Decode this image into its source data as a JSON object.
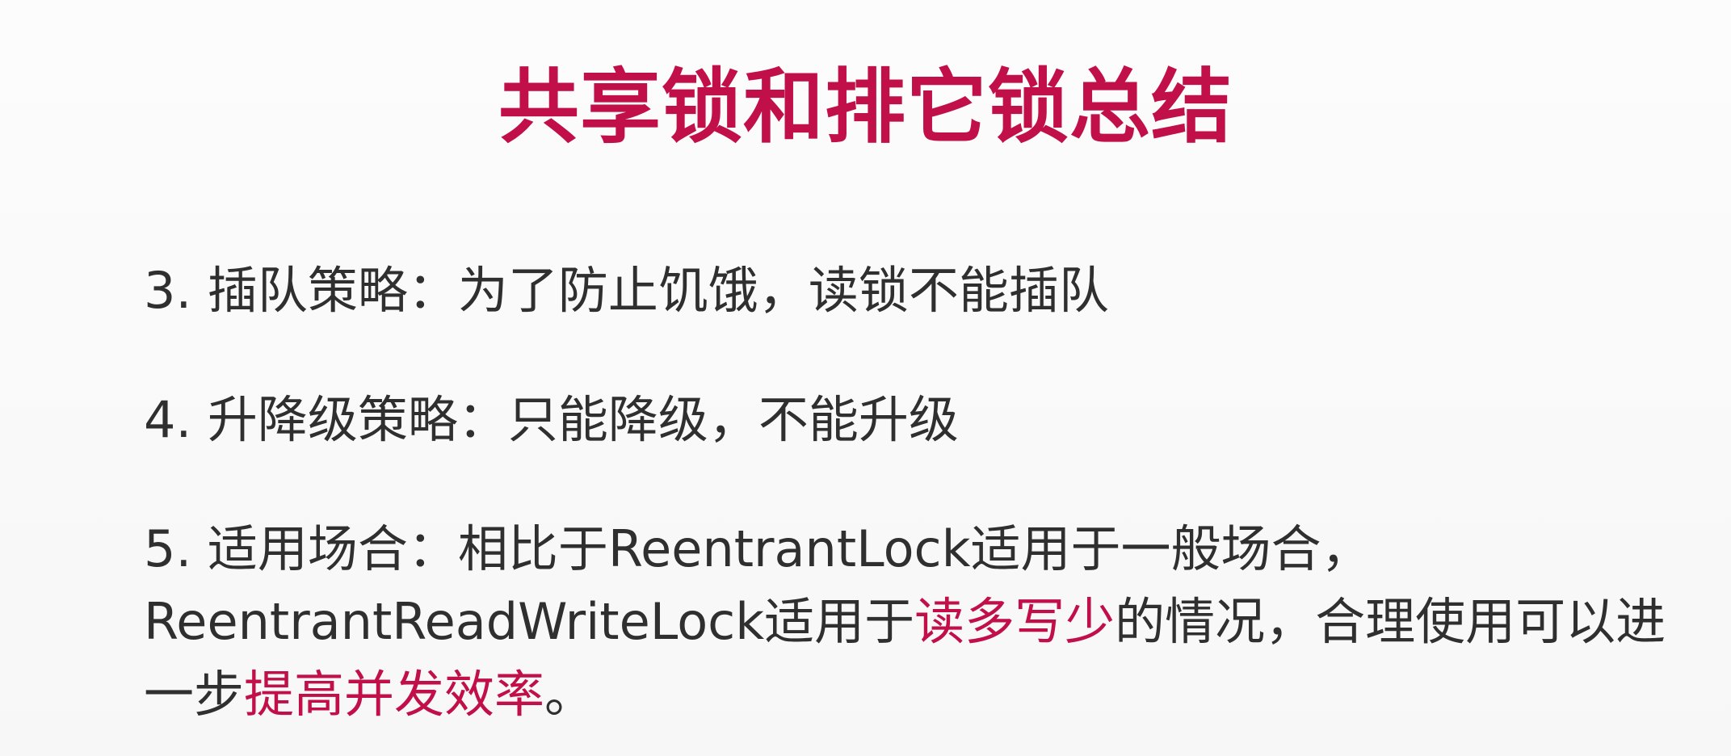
{
  "slide": {
    "title": "共享锁和排它锁总结",
    "points": [
      {
        "text": "3. 插队策略：为了防止饥饿，读锁不能插队"
      },
      {
        "text": "4. 升降级策略：只能降级，不能升级"
      },
      {
        "line1": "5. 适用场合：相比于ReentrantLock适用于一般场合，",
        "line2_pre": "ReentrantReadWriteLock适用于",
        "line2_highlight": "读多写少",
        "line2_post": "的情况，合理使用可以进",
        "line3_pre": "一步",
        "line3_highlight": "提高并发效率",
        "line3_post": "。"
      }
    ]
  },
  "colors": {
    "accent": "#c10f4a",
    "text": "#2f2f2f",
    "background": "#fbfbfb"
  }
}
